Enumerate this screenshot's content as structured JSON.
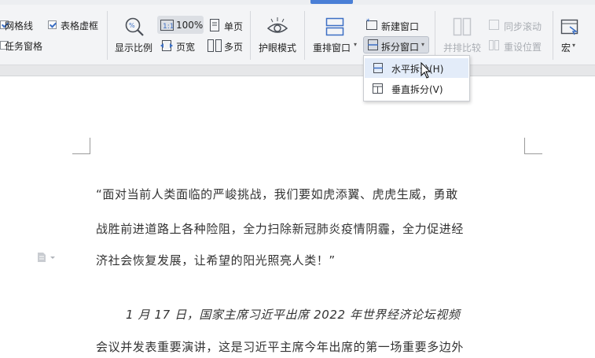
{
  "ribbon": {
    "grid_lines": {
      "label": "网格线",
      "checked": true
    },
    "table_dashed": {
      "label": "表格虚框",
      "checked": true
    },
    "task_pane": {
      "label": "任务窗格",
      "checked": false
    },
    "zoom_label": "显示比例",
    "zoom_value": "100%",
    "page_width": "页宽",
    "single_page": "单页",
    "multi_page": "多页",
    "eye_mode": "护眼模式",
    "rearrange": "重排窗口",
    "new_window": "新建窗口",
    "split_window": "拆分窗口",
    "side_by_side": "并排比较",
    "sync_scroll": "同步滚动",
    "reset_position": "重设位置",
    "macro": "宏"
  },
  "split_menu": {
    "items": [
      {
        "label": "水平拆分(H)",
        "highlighted": true
      },
      {
        "label": "垂直拆分(V)",
        "highlighted": false
      }
    ]
  },
  "document": {
    "lines": [
      "“面对当前人类面临的严峻挑战，我们要如虎添翼、虎虎生威，勇敢",
      "战胜前进道路上各种险阻，全力扫除新冠肺炎疫情阴霾，全力促进经",
      "济社会恢复发展，让希望的阳光照亮人类！”",
      "1 月 17 日，国家主席习近平出席 2022 年世界经济论坛视频",
      "会议并发表重要演讲，这是习近平主席今年出席的第一场重要多边外"
    ]
  },
  "colors": {
    "ribbon_bg": "#f3f4f6",
    "accent": "#3c6fc4",
    "menu_highlight": "#e3ecf9"
  }
}
